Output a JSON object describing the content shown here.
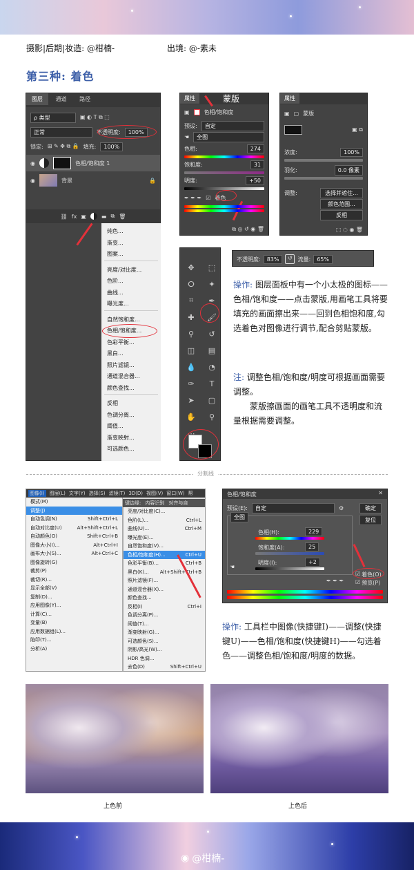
{
  "header": {
    "credit": "摄影|后期|妆造: @柑楠-",
    "source": "出境: @-素未"
  },
  "section_title": "第三种: 着色",
  "layers_panel": {
    "tabs": [
      "图层",
      "通道",
      "路径"
    ],
    "filter_kind": "ρ 类型",
    "blend_mode": "正常",
    "opacity_label": "不透明度:",
    "opacity_value": "100%",
    "lock_label": "锁定:",
    "fill_label": "填充:",
    "fill_value": "100%",
    "layers": [
      {
        "name": "色相/饱和度 1"
      },
      {
        "name": "背景"
      }
    ],
    "adjust_menu": {
      "group1": [
        "纯色...",
        "渐变...",
        "图案..."
      ],
      "group2": [
        "亮度/对比度...",
        "色阶...",
        "曲线...",
        "曝光度..."
      ],
      "group3": [
        "自然饱和度...",
        "色相/饱和度...",
        "色彩平衡...",
        "黑白...",
        "照片滤镜...",
        "通道混合器...",
        "颜色查找..."
      ],
      "group4": [
        "反相",
        "色调分离...",
        "阈值...",
        "渐变映射...",
        "可选颜色..."
      ]
    }
  },
  "properties_hue": {
    "tab": "属性",
    "annotation": "蒙版",
    "type_label": "色相/饱和度",
    "preset_label": "预设:",
    "preset_value": "自定",
    "channel_value": "全图",
    "hue_label": "色相:",
    "hue_value": "274",
    "sat_label": "饱和度:",
    "sat_value": "31",
    "light_label": "明度:",
    "light_value": "+50",
    "colorize_label": "着色"
  },
  "properties_mask": {
    "tab": "属性",
    "type_label": "蒙版",
    "density_label": "浓度:",
    "density_value": "100%",
    "feather_label": "羽化:",
    "feather_value": "0.0 像素",
    "refine_label": "调整:",
    "buttons": [
      "选择并遮住...",
      "颜色范围...",
      "反相"
    ]
  },
  "brush_bar": {
    "opacity_label": "不透明度:",
    "opacity_value": "83%",
    "flow_label": "流量:",
    "flow_value": "65%"
  },
  "toolbar_icons": [
    "move-icon",
    "marquee-icon",
    "lasso-icon",
    "magic-wand-icon",
    "crop-icon",
    "eyedropper-icon",
    "healing-icon",
    "brush-icon",
    "stamp-icon",
    "history-brush-icon",
    "eraser-icon",
    "gradient-icon",
    "blur-icon",
    "dodge-icon",
    "pen-icon",
    "type-icon",
    "path-select-icon",
    "shape-icon",
    "hand-icon",
    "zoom-icon",
    "more-icon"
  ],
  "notes": {
    "op1_label": "操作:",
    "op1_text": "图层面板中有一个小太极的图标——色相/饱和度——点击蒙版,用画笔工具将要填充的画面擦出来——回到色相饱和度,勾选着色对图像进行调节,配合剪贴蒙版。",
    "note_label": "注:",
    "note_text1": "调整色相/饱和度/明度可根据画面需要调整。",
    "note_text2": "蒙版擦画面的画笔工具不透明度和流量根据需要调整。"
  },
  "divider_label": "分割线",
  "image_menu": {
    "menubar": [
      "图像(I)",
      "图层(L)",
      "文字(Y)",
      "选择(S)",
      "滤镜(T)",
      "3D(D)",
      "视图(V)",
      "窗口(W)",
      "帮"
    ],
    "options_bar": [
      "键边缘:",
      "内容识别",
      "对齐与自"
    ],
    "items": [
      {
        "label": "模式(M)",
        "key": ""
      },
      {
        "label": "调整(J)",
        "key": ""
      },
      {
        "label": "自动色调(N)",
        "key": "Shift+Ctrl+L"
      },
      {
        "label": "自动对比度(U)",
        "key": "Alt+Shift+Ctrl+L"
      },
      {
        "label": "自动颜色(O)",
        "key": "Shift+Ctrl+B"
      },
      {
        "label": "图像大小(I)...",
        "key": "Alt+Ctrl+I"
      },
      {
        "label": "画布大小(S)...",
        "key": "Alt+Ctrl+C"
      },
      {
        "label": "图像旋转(G)",
        "key": ""
      },
      {
        "label": "裁剪(P)",
        "key": ""
      },
      {
        "label": "裁切(R)...",
        "key": ""
      },
      {
        "label": "显示全部(V)",
        "key": ""
      },
      {
        "label": "复制(D)...",
        "key": ""
      },
      {
        "label": "应用图像(Y)...",
        "key": ""
      },
      {
        "label": "计算(C)...",
        "key": ""
      },
      {
        "label": "变量(B)",
        "key": ""
      },
      {
        "label": "应用数据组(L)...",
        "key": ""
      },
      {
        "label": "陷印(T)...",
        "key": ""
      },
      {
        "label": "分析(A)",
        "key": ""
      }
    ],
    "submenu": [
      {
        "label": "亮度/对比度(C)...",
        "key": ""
      },
      {
        "label": "色阶(L)...",
        "key": "Ctrl+L"
      },
      {
        "label": "曲线(U)...",
        "key": "Ctrl+M"
      },
      {
        "label": "曝光度(E)...",
        "key": ""
      },
      {
        "label": "自然饱和度(V)...",
        "key": ""
      },
      {
        "label": "色相/饱和度(H)...",
        "key": "Ctrl+U"
      },
      {
        "label": "色彩平衡(B)...",
        "key": "Ctrl+B"
      },
      {
        "label": "黑白(K)...",
        "key": "Alt+Shift+Ctrl+B"
      },
      {
        "label": "照片滤镜(F)...",
        "key": ""
      },
      {
        "label": "通道混合器(X)...",
        "key": ""
      },
      {
        "label": "颜色查找...",
        "key": ""
      },
      {
        "label": "反相(I)",
        "key": "Ctrl+I"
      },
      {
        "label": "色调分离(P)...",
        "key": ""
      },
      {
        "label": "阈值(T)...",
        "key": ""
      },
      {
        "label": "渐变映射(G)...",
        "key": ""
      },
      {
        "label": "可选颜色(S)...",
        "key": ""
      },
      {
        "label": "阴影/高光(W)...",
        "key": ""
      },
      {
        "label": "HDR 色调...",
        "key": ""
      },
      {
        "label": "去色(D)",
        "key": "Shift+Ctrl+U"
      }
    ]
  },
  "hue_dialog": {
    "title": "色相/饱和度",
    "preset_label": "预设(E):",
    "preset_value": "自定",
    "channel_value": "全图",
    "hue_label": "色相(H):",
    "hue_value": "229",
    "sat_label": "饱和度(A):",
    "sat_value": "25",
    "light_label": "明度(I):",
    "light_value": "+2",
    "ok": "确定",
    "reset": "复位",
    "colorize": "着色(O)",
    "preview": "预览(P)"
  },
  "notes2": {
    "op_label": "操作:",
    "op_text": "工具栏中图像(快捷键I)——调整(快捷键U)——色相/饱和度(快捷键H)——勾选着色——调整色相/饱和度/明度的数据。"
  },
  "photos": {
    "before": "上色前",
    "after": "上色后"
  },
  "footer": {
    "watermark": "@柑楠-"
  },
  "colors": {
    "accent": "#3d5fa8",
    "highlight": "#e3313a",
    "ps_panel": "#434343"
  }
}
